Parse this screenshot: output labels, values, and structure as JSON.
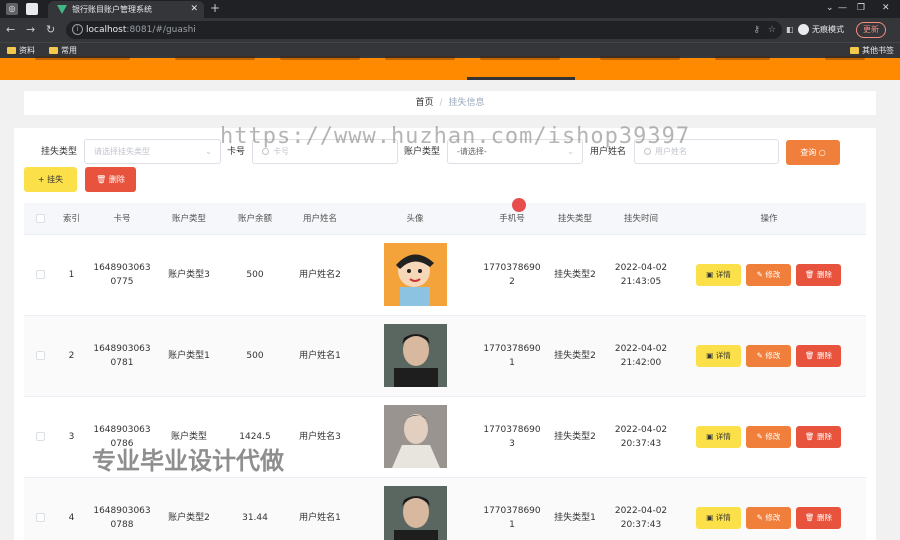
{
  "browser": {
    "tab_title": "银行账目账户管理系统",
    "url_host": "localhost",
    "url_path": ":8081/#/guashi",
    "incognito_label": "无痕模式",
    "update_label": "更新",
    "bookmarks": [
      "资料",
      "常用"
    ],
    "other_bookmarks": "其他书签"
  },
  "breadcrumb": {
    "home": "首页",
    "separator": "/",
    "current": "挂失信息"
  },
  "filters": {
    "loss_type_label": "挂失类型",
    "loss_type_placeholder": "请选择挂失类型",
    "card_label": "卡号",
    "card_placeholder": "卡号",
    "account_type_label": "账户类型",
    "account_type_value": "-请选择-",
    "user_name_label": "用户姓名",
    "user_name_placeholder": "用户姓名",
    "search_label": "查询 ○"
  },
  "actions": {
    "add_label": "+ 挂失",
    "delete_label": "🗑 删除"
  },
  "table": {
    "headers": [
      "索引",
      "卡号",
      "账户类型",
      "账户余额",
      "用户姓名",
      "头像",
      "手机号",
      "挂失类型",
      "挂失时间",
      "操作"
    ],
    "rows": [
      {
        "index": "1",
        "card": "1648903063\n0775",
        "account_type": "账户类型3",
        "balance": "500",
        "user_name": "用户姓名2",
        "phone": "1770378690\n2",
        "loss_type": "挂失类型2",
        "time": "2022-04-02\n21:43:05"
      },
      {
        "index": "2",
        "card": "1648903063\n0781",
        "account_type": "账户类型1",
        "balance": "500",
        "user_name": "用户姓名1",
        "phone": "1770378690\n1",
        "loss_type": "挂失类型2",
        "time": "2022-04-02\n21:42:00"
      },
      {
        "index": "3",
        "card": "1648903063\n0786",
        "account_type": "账户类型",
        "balance": "1424.5",
        "user_name": "用户姓名3",
        "phone": "1770378690\n3",
        "loss_type": "挂失类型2",
        "time": "2022-04-02\n20:37:43"
      },
      {
        "index": "4",
        "card": "1648903063\n0788",
        "account_type": "账户类型2",
        "balance": "31.44",
        "user_name": "用户姓名1",
        "phone": "1770378690\n1",
        "loss_type": "挂失类型1",
        "time": "2022-04-02\n20:37:43"
      }
    ],
    "row_actions": {
      "detail": "详情",
      "edit": "修改",
      "delete": "删除"
    }
  },
  "watermarks": {
    "url": "https://www.huzhan.com/ishop39397",
    "text": "专业毕业设计代做"
  },
  "colors": {
    "nav": "#ff8a00",
    "yellow": "#fbe049",
    "orange": "#f07f3c",
    "red": "#e7533c"
  }
}
